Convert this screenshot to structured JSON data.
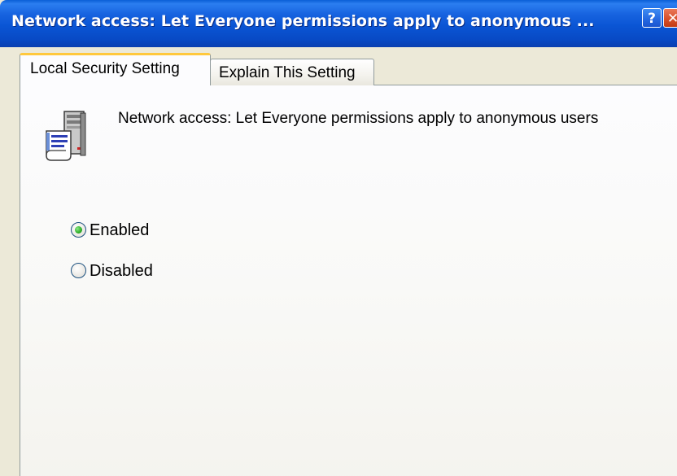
{
  "window": {
    "title": "Network access: Let Everyone permissions apply to anonymous ...",
    "help_label": "?",
    "close_label": "✕"
  },
  "tabs": [
    {
      "label": "Local Security Setting",
      "active": true
    },
    {
      "label": "Explain This Setting",
      "active": false
    }
  ],
  "policy": {
    "icon": "security-policy-server-icon",
    "title": "Network access: Let Everyone permissions apply to anonymous users"
  },
  "options": {
    "enabled": {
      "label": "Enabled",
      "checked": true
    },
    "disabled": {
      "label": "Disabled",
      "checked": false
    }
  },
  "colors": {
    "titlebar": "#0a55d4",
    "active_tab_accent": "#ffc83c",
    "radio_checked": "#33b22d",
    "dialog_background": "#ece9d8"
  }
}
